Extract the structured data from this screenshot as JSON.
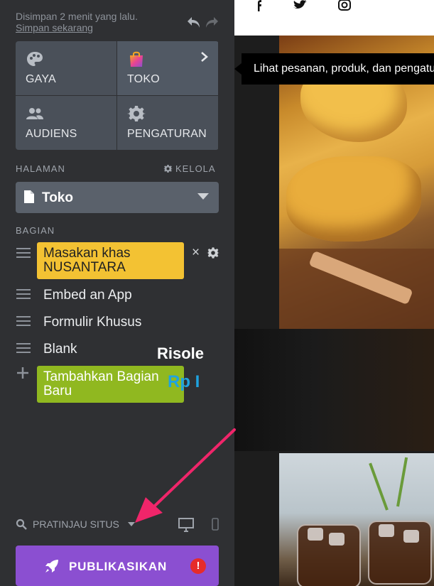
{
  "sidebar": {
    "saved_text": "Disimpan 2 menit yang lalu.",
    "save_now_link": "Simpan sekarang",
    "tiles": [
      {
        "label": "GAYA",
        "icon": "palette-icon"
      },
      {
        "label": "TOKO",
        "icon": "shopping-bag-icon",
        "active": true
      },
      {
        "label": "AUDIENS",
        "icon": "people-icon"
      },
      {
        "label": "PENGATURAN",
        "icon": "gear-icon"
      }
    ],
    "pages_label": "HALAMAN",
    "manage_label": "KELOLA",
    "selected_page": "Toko",
    "sections_label": "BAGIAN",
    "sections": [
      {
        "label": "Masakan khas NUSANTARA",
        "style": "highlighted"
      },
      {
        "label": "Embed an App"
      },
      {
        "label": "Formulir Khusus"
      },
      {
        "label": "Blank"
      }
    ],
    "add_section_label": "Tambahkan Bagian Baru",
    "preview_label": "PRATINJAU SITUS",
    "publish_label": "PUBLIKASIKAN",
    "publish_alert": "!"
  },
  "tooltip": {
    "text": "Lihat pesanan, produk, dan pengaturan toko"
  },
  "site": {
    "social_icons": [
      "facebook-icon",
      "twitter-icon",
      "instagram-icon"
    ],
    "product_name": "Risole",
    "product_price": "Rp I"
  },
  "colors": {
    "sidebar_bg": "#2f3033",
    "tile_bg": "#4a5059",
    "highlight_section": "#f3c233",
    "add_section": "#90b820",
    "publish": "#8b4fd1",
    "price": "#1fa3e0"
  }
}
